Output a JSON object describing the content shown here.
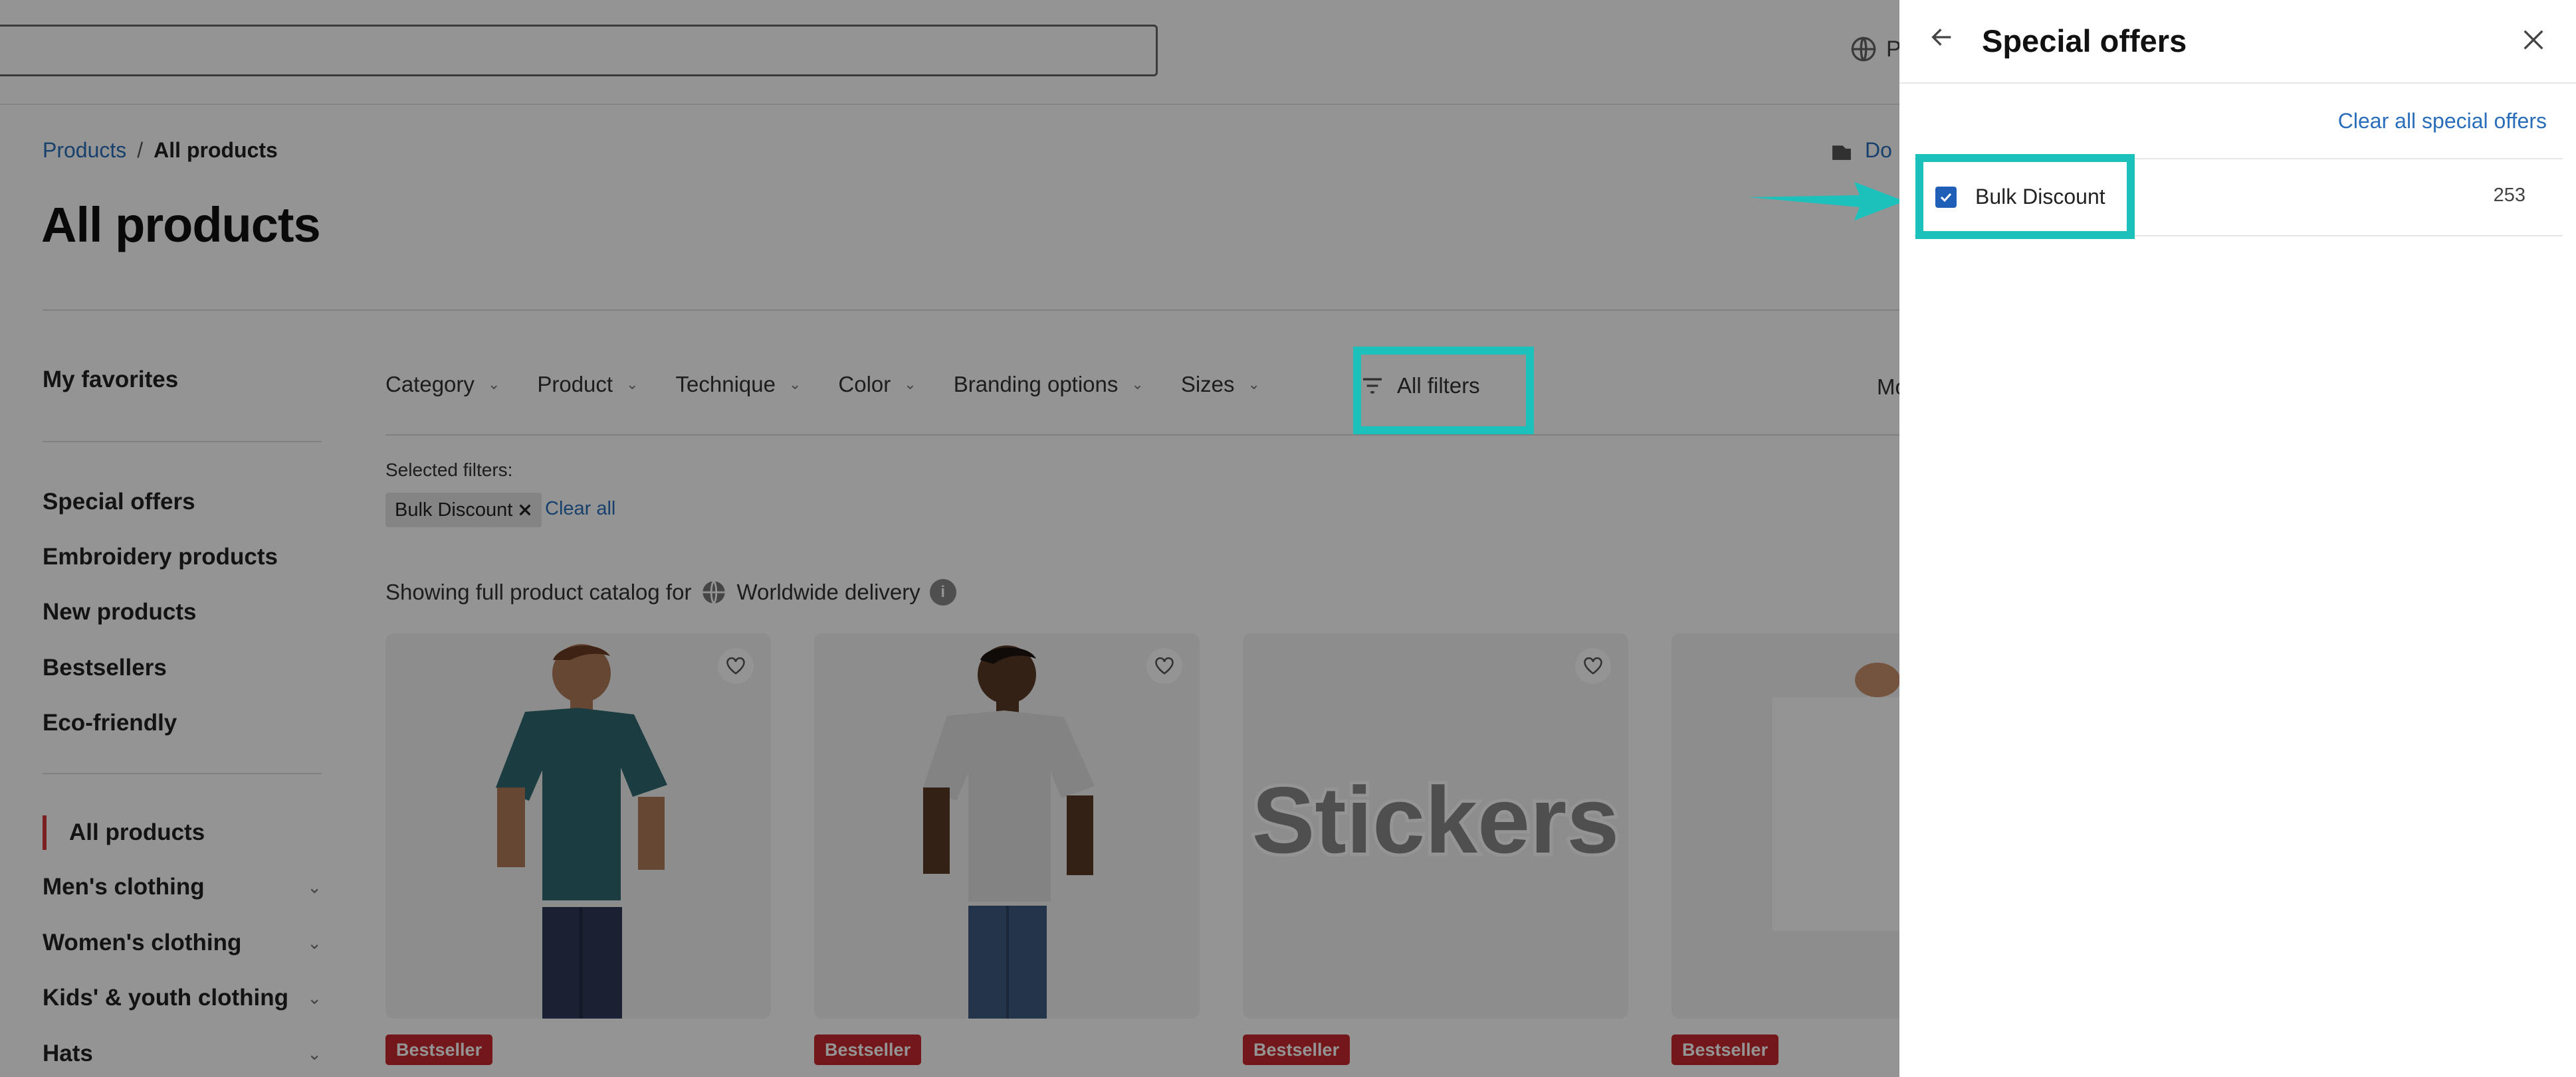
{
  "header": {
    "language_label": "P"
  },
  "breadcrumb": {
    "parent": "Products",
    "separator": "/",
    "current": "All products"
  },
  "download_label": "Do",
  "page_title": "All products",
  "sidebar": {
    "favorites": "My favorites",
    "collections": [
      "Special offers",
      "Embroidery products",
      "New products",
      "Bestsellers",
      "Eco-friendly"
    ],
    "active": "All products",
    "categories": [
      "Men's clothing",
      "Women's clothing",
      "Kids' & youth clothing",
      "Hats"
    ]
  },
  "filters": {
    "items": [
      "Category",
      "Product",
      "Technique",
      "Color",
      "Branding options",
      "Sizes"
    ],
    "all_filters": "All filters",
    "more": "Mo",
    "selected_label": "Selected filters:",
    "chip": "Bulk Discount",
    "clear_all": "Clear all"
  },
  "catalog": {
    "prefix": "Showing full product catalog for",
    "region": "Worldwide delivery",
    "info": "i"
  },
  "cards": {
    "badge": "Bestseller",
    "sticker_text": "Stickers"
  },
  "panel": {
    "title": "Special offers",
    "clear_label": "Clear all special offers",
    "option_label": "Bulk Discount",
    "option_count": "253",
    "option_checked": true
  },
  "colors": {
    "accent_highlight": "#1cc1bb",
    "badge": "#c8282d",
    "link": "#2a6ebb",
    "checkbox": "#1f5fb8"
  }
}
